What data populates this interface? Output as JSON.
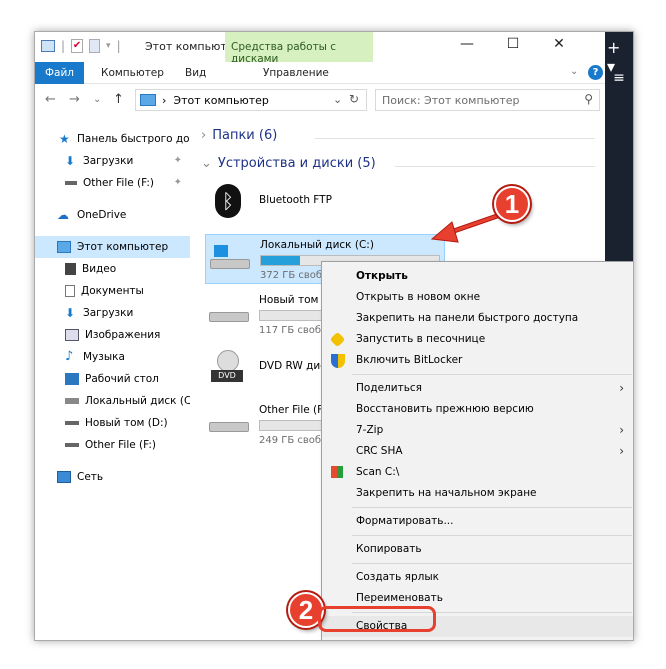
{
  "titlebar": {
    "title": "Этот компьют...",
    "contextual_tab_header": "Средства работы с дисками",
    "minimize": "—",
    "maximize": "☐",
    "close": "✕"
  },
  "ribbon": {
    "tabs": [
      "Файл",
      "Компьютер",
      "Вид",
      "Управление"
    ],
    "help": "?"
  },
  "address": {
    "path": "Этот компьютер",
    "search_placeholder": "Поиск: Этот компьютер"
  },
  "sidebar": {
    "items": [
      {
        "label": "Панель быстрого до",
        "pinned": false
      },
      {
        "label": "Загрузки",
        "pinned": true
      },
      {
        "label": "Other File (F:)",
        "pinned": true
      },
      {
        "label": "OneDrive"
      },
      {
        "label": "Этот компьютер",
        "selected": true
      },
      {
        "label": "Видео"
      },
      {
        "label": "Документы"
      },
      {
        "label": "Загрузки"
      },
      {
        "label": "Изображения"
      },
      {
        "label": "Музыка"
      },
      {
        "label": "Рабочий стол"
      },
      {
        "label": "Локальный диск (C"
      },
      {
        "label": "Новый том (D:)"
      },
      {
        "label": "Other File (F:)"
      },
      {
        "label": "Сеть"
      }
    ]
  },
  "content": {
    "folders_group": "Папки (6)",
    "devices_group": "Устройства и диски (5)",
    "bluetooth": "Bluetooth FTP",
    "drives": [
      {
        "name": "Локальный диск (C:)",
        "free": "372 ГБ свобо",
        "used_fraction": 0.22
      },
      {
        "name": "Новый том (",
        "free": "117 ГБ свобо",
        "used_fraction": 0.0
      },
      {
        "name": "DVD RW дис",
        "free": ""
      },
      {
        "name": "Other File (F:",
        "free": "249 ГБ свобо",
        "used_fraction": 0.0
      }
    ]
  },
  "context_menu": {
    "items": [
      "Открыть",
      "Открыть в новом окне",
      "Закрепить на панели быстрого доступа",
      "Запустить в песочнице",
      "Включить BitLocker",
      "Поделиться",
      "Восстановить прежнюю версию",
      "7-Zip",
      "CRC SHA",
      "Scan C:\\",
      "Закрепить на начальном экране",
      "Форматировать...",
      "Копировать",
      "Создать ярлык",
      "Переименовать",
      "Свойства"
    ]
  },
  "callouts": {
    "one": "1",
    "two": "2"
  },
  "colors": {
    "accent": "#1979ca",
    "callout": "#e8402e",
    "selection": "#cce8ff"
  }
}
